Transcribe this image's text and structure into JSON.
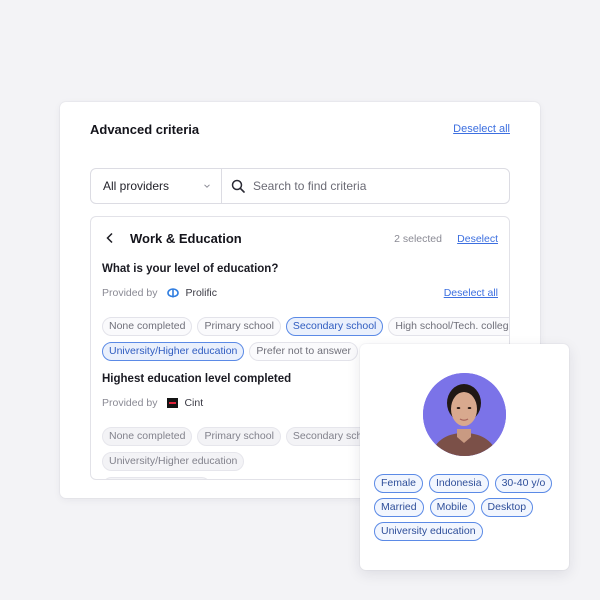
{
  "advanced_criteria": {
    "title": "Advanced criteria",
    "deselect_all_label": "Deselect all",
    "provider_filter": {
      "selected": "All providers",
      "icon": "chevron-down-icon"
    },
    "search": {
      "placeholder": "Search to find criteria",
      "value": "",
      "icon": "search-icon"
    },
    "category": {
      "back_icon": "chevron-left-icon",
      "title": "Work & Education",
      "selected_count": "2 selected",
      "deselect_label": "Deselect",
      "questions": [
        {
          "question": "What is your level of education?",
          "provided_by_label": "Provided by",
          "provider": "Prolific",
          "provider_icon": "prolific-logo-icon",
          "deselect_all_label": "Deselect all",
          "options": [
            {
              "label": "None completed",
              "selected": false
            },
            {
              "label": "Primary school",
              "selected": false
            },
            {
              "label": "Secondary school",
              "selected": true
            },
            {
              "label": "High school/Tech. college",
              "selected": false
            },
            {
              "label": "University/Higher education",
              "selected": true
            },
            {
              "label": "Prefer not to answer",
              "selected": false
            }
          ]
        },
        {
          "question": "Highest education level completed",
          "provided_by_label": "Provided by",
          "provider": "Cint",
          "provider_icon": "cint-logo-icon",
          "options": [
            {
              "label": "None completed",
              "selected": false
            },
            {
              "label": "Primary school",
              "selected": false
            },
            {
              "label": "Secondary school",
              "selected": false
            },
            {
              "label": "University/Higher education",
              "selected": false
            },
            {
              "label": "Prefer not to answer",
              "selected": false
            }
          ]
        }
      ]
    }
  },
  "profile": {
    "avatar": "participant-photo",
    "avatar_bg": "#7b73e8",
    "tags": [
      "Female",
      "Indonesia",
      "30-40 y/o",
      "Married",
      "Mobile",
      "Desktop",
      "University education"
    ]
  },
  "colors": {
    "accent": "#3c6fe0",
    "selected_border": "#5b8ae6",
    "selected_bg": "#eaf0fc"
  }
}
